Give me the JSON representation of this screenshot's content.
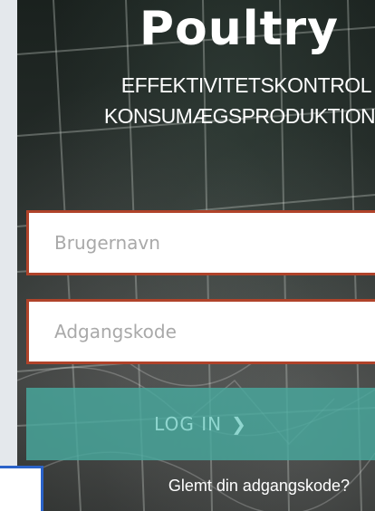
{
  "brand": {
    "title": "Poultry",
    "subtitle_line1": "EFFEKTIVITETSKONTROL",
    "subtitle_line2": "KONSUMÆGSPRODUKTION"
  },
  "form": {
    "username_placeholder": "Brugernavn",
    "username_value": "",
    "password_placeholder": "Adgangskode",
    "password_value": "",
    "login_label": "LOG IN",
    "login_chevron": "❯",
    "forgot_label": "Glemt din adgangskode?"
  },
  "colors": {
    "field_border": "#b0432a",
    "login_button": "#48a89e",
    "login_text": "#8fd6cf",
    "overlay_border": "#2b63c9"
  },
  "icons": {
    "login_arrow": "chevron-right-icon"
  }
}
